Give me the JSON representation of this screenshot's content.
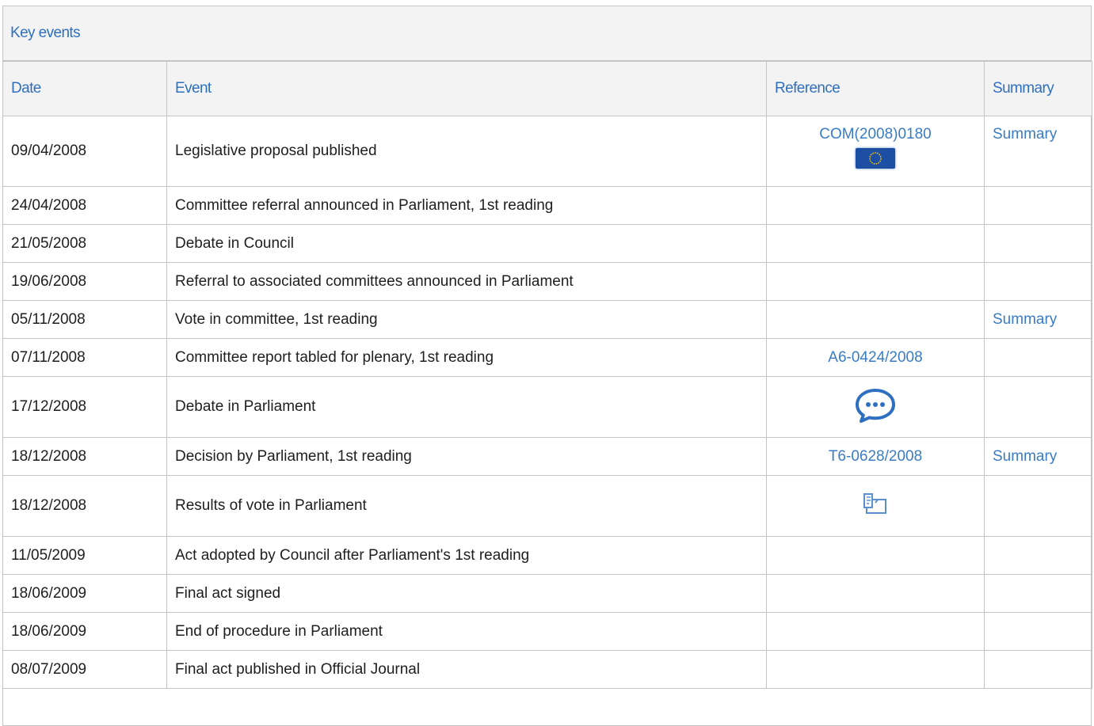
{
  "panel": {
    "title": "Key events"
  },
  "headers": {
    "date": "Date",
    "event": "Event",
    "reference": "Reference",
    "summary": "Summary"
  },
  "rows": [
    {
      "date": "09/04/2008",
      "event": "Legislative proposal published",
      "reference": "COM(2008)0180",
      "ref_icon": "eu-flag-icon",
      "summary": "Summary"
    },
    {
      "date": "24/04/2008",
      "event": "Committee referral announced in Parliament, 1st reading",
      "reference": "",
      "summary": ""
    },
    {
      "date": "21/05/2008",
      "event": "Debate in Council",
      "reference": "",
      "summary": ""
    },
    {
      "date": "19/06/2008",
      "event": "Referral to associated committees announced in Parliament",
      "reference": "",
      "summary": ""
    },
    {
      "date": "05/11/2008",
      "event": "Vote in committee, 1st reading",
      "reference": "",
      "summary": "Summary"
    },
    {
      "date": "07/11/2008",
      "event": "Committee report tabled for plenary, 1st reading",
      "reference": "A6-0424/2008",
      "summary": ""
    },
    {
      "date": "17/12/2008",
      "event": "Debate in Parliament",
      "reference": "",
      "ref_icon": "speech-bubble-icon",
      "summary": ""
    },
    {
      "date": "18/12/2008",
      "event": "Decision by Parliament, 1st reading",
      "reference": "T6-0628/2008",
      "summary": "Summary"
    },
    {
      "date": "18/12/2008",
      "event": "Results of vote in Parliament",
      "reference": "",
      "ref_icon": "vote-results-icon",
      "summary": ""
    },
    {
      "date": "11/05/2009",
      "event": "Act adopted by Council after Parliament's 1st reading",
      "reference": "",
      "summary": ""
    },
    {
      "date": "18/06/2009",
      "event": "Final act signed",
      "reference": "",
      "summary": ""
    },
    {
      "date": "18/06/2009",
      "event": "End of procedure in Parliament",
      "reference": "",
      "summary": ""
    },
    {
      "date": "08/07/2009",
      "event": "Final act published in Official Journal",
      "reference": "",
      "summary": ""
    }
  ],
  "colors": {
    "link": "#3a7cc4",
    "header_text": "#2f6fbf",
    "header_bg": "#f3f3f3",
    "border": "#c4c4c4",
    "eu_blue": "#1c4fa3"
  }
}
